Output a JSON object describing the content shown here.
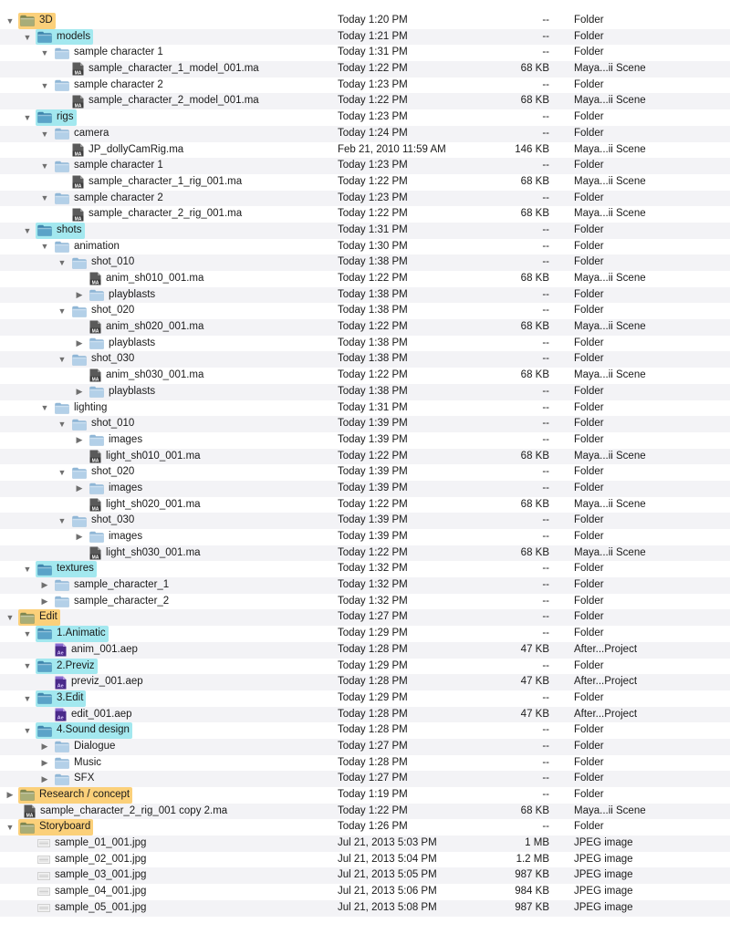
{
  "window": {
    "view": "Finder list view"
  },
  "colors": {
    "row_alt": "#f3f3f6",
    "label_orange": "#fbd07a",
    "label_cyan": "#a3e8ef",
    "folder_blue": "#8fb6d6",
    "folder_olive": "#9aa36a",
    "ae_purple": "#4a2a8a"
  },
  "rows": [
    {
      "name": "3D",
      "depth": 0,
      "disclosure": "open",
      "icon": "folder-icon",
      "label": "orange",
      "date": "Today 1:20 PM",
      "size": "--",
      "kind": "Folder"
    },
    {
      "name": "models",
      "depth": 1,
      "disclosure": "open",
      "icon": "folder-icon",
      "label": "cyan",
      "date": "Today 1:21 PM",
      "size": "--",
      "kind": "Folder"
    },
    {
      "name": "sample character 1",
      "depth": 2,
      "disclosure": "open",
      "icon": "folder-icon",
      "label": "",
      "date": "Today 1:31 PM",
      "size": "--",
      "kind": "Folder"
    },
    {
      "name": "sample_character_1_model_001.ma",
      "depth": 3,
      "disclosure": "none",
      "icon": "maya-file-icon",
      "label": "",
      "date": "Today 1:22 PM",
      "size": "68 KB",
      "kind": "Maya...ii Scene"
    },
    {
      "name": "sample character 2",
      "depth": 2,
      "disclosure": "open",
      "icon": "folder-icon",
      "label": "",
      "date": "Today 1:23 PM",
      "size": "--",
      "kind": "Folder"
    },
    {
      "name": "sample_character_2_model_001.ma",
      "depth": 3,
      "disclosure": "none",
      "icon": "maya-file-icon",
      "label": "",
      "date": "Today 1:22 PM",
      "size": "68 KB",
      "kind": "Maya...ii Scene"
    },
    {
      "name": "rigs",
      "depth": 1,
      "disclosure": "open",
      "icon": "folder-icon",
      "label": "cyan",
      "date": "Today 1:23 PM",
      "size": "--",
      "kind": "Folder"
    },
    {
      "name": "camera",
      "depth": 2,
      "disclosure": "open",
      "icon": "folder-icon",
      "label": "",
      "date": "Today 1:24 PM",
      "size": "--",
      "kind": "Folder"
    },
    {
      "name": "JP_dollyCamRig.ma",
      "depth": 3,
      "disclosure": "none",
      "icon": "maya-file-icon",
      "label": "",
      "date": "Feb 21, 2010 11:59 AM",
      "size": "146 KB",
      "kind": "Maya...ii Scene"
    },
    {
      "name": "sample character 1",
      "depth": 2,
      "disclosure": "open",
      "icon": "folder-icon",
      "label": "",
      "date": "Today 1:23 PM",
      "size": "--",
      "kind": "Folder"
    },
    {
      "name": "sample_character_1_rig_001.ma",
      "depth": 3,
      "disclosure": "none",
      "icon": "maya-file-icon",
      "label": "",
      "date": "Today 1:22 PM",
      "size": "68 KB",
      "kind": "Maya...ii Scene"
    },
    {
      "name": "sample character 2",
      "depth": 2,
      "disclosure": "open",
      "icon": "folder-icon",
      "label": "",
      "date": "Today 1:23 PM",
      "size": "--",
      "kind": "Folder"
    },
    {
      "name": "sample_character_2_rig_001.ma",
      "depth": 3,
      "disclosure": "none",
      "icon": "maya-file-icon",
      "label": "",
      "date": "Today 1:22 PM",
      "size": "68 KB",
      "kind": "Maya...ii Scene"
    },
    {
      "name": "shots",
      "depth": 1,
      "disclosure": "open",
      "icon": "folder-icon",
      "label": "cyan",
      "date": "Today 1:31 PM",
      "size": "--",
      "kind": "Folder"
    },
    {
      "name": "animation",
      "depth": 2,
      "disclosure": "open",
      "icon": "folder-icon",
      "label": "",
      "date": "Today 1:30 PM",
      "size": "--",
      "kind": "Folder"
    },
    {
      "name": "shot_010",
      "depth": 3,
      "disclosure": "open",
      "icon": "folder-icon",
      "label": "",
      "date": "Today 1:38 PM",
      "size": "--",
      "kind": "Folder"
    },
    {
      "name": "anim_sh010_001.ma",
      "depth": 4,
      "disclosure": "none",
      "icon": "maya-file-icon",
      "label": "",
      "date": "Today 1:22 PM",
      "size": "68 KB",
      "kind": "Maya...ii Scene"
    },
    {
      "name": "playblasts",
      "depth": 4,
      "disclosure": "closed",
      "icon": "folder-icon",
      "label": "",
      "date": "Today 1:38 PM",
      "size": "--",
      "kind": "Folder"
    },
    {
      "name": "shot_020",
      "depth": 3,
      "disclosure": "open",
      "icon": "folder-icon",
      "label": "",
      "date": "Today 1:38 PM",
      "size": "--",
      "kind": "Folder"
    },
    {
      "name": "anim_sh020_001.ma",
      "depth": 4,
      "disclosure": "none",
      "icon": "maya-file-icon",
      "label": "",
      "date": "Today 1:22 PM",
      "size": "68 KB",
      "kind": "Maya...ii Scene"
    },
    {
      "name": "playblasts",
      "depth": 4,
      "disclosure": "closed",
      "icon": "folder-icon",
      "label": "",
      "date": "Today 1:38 PM",
      "size": "--",
      "kind": "Folder"
    },
    {
      "name": "shot_030",
      "depth": 3,
      "disclosure": "open",
      "icon": "folder-icon",
      "label": "",
      "date": "Today 1:38 PM",
      "size": "--",
      "kind": "Folder"
    },
    {
      "name": "anim_sh030_001.ma",
      "depth": 4,
      "disclosure": "none",
      "icon": "maya-file-icon",
      "label": "",
      "date": "Today 1:22 PM",
      "size": "68 KB",
      "kind": "Maya...ii Scene"
    },
    {
      "name": "playblasts",
      "depth": 4,
      "disclosure": "closed",
      "icon": "folder-icon",
      "label": "",
      "date": "Today 1:38 PM",
      "size": "--",
      "kind": "Folder"
    },
    {
      "name": "lighting",
      "depth": 2,
      "disclosure": "open",
      "icon": "folder-icon",
      "label": "",
      "date": "Today 1:31 PM",
      "size": "--",
      "kind": "Folder"
    },
    {
      "name": "shot_010",
      "depth": 3,
      "disclosure": "open",
      "icon": "folder-icon",
      "label": "",
      "date": "Today 1:39 PM",
      "size": "--",
      "kind": "Folder"
    },
    {
      "name": "images",
      "depth": 4,
      "disclosure": "closed",
      "icon": "folder-icon",
      "label": "",
      "date": "Today 1:39 PM",
      "size": "--",
      "kind": "Folder"
    },
    {
      "name": "light_sh010_001.ma",
      "depth": 4,
      "disclosure": "none",
      "icon": "maya-file-icon",
      "label": "",
      "date": "Today 1:22 PM",
      "size": "68 KB",
      "kind": "Maya...ii Scene"
    },
    {
      "name": "shot_020",
      "depth": 3,
      "disclosure": "open",
      "icon": "folder-icon",
      "label": "",
      "date": "Today 1:39 PM",
      "size": "--",
      "kind": "Folder"
    },
    {
      "name": "images",
      "depth": 4,
      "disclosure": "closed",
      "icon": "folder-icon",
      "label": "",
      "date": "Today 1:39 PM",
      "size": "--",
      "kind": "Folder"
    },
    {
      "name": "light_sh020_001.ma",
      "depth": 4,
      "disclosure": "none",
      "icon": "maya-file-icon",
      "label": "",
      "date": "Today 1:22 PM",
      "size": "68 KB",
      "kind": "Maya...ii Scene"
    },
    {
      "name": "shot_030",
      "depth": 3,
      "disclosure": "open",
      "icon": "folder-icon",
      "label": "",
      "date": "Today 1:39 PM",
      "size": "--",
      "kind": "Folder"
    },
    {
      "name": "images",
      "depth": 4,
      "disclosure": "closed",
      "icon": "folder-icon",
      "label": "",
      "date": "Today 1:39 PM",
      "size": "--",
      "kind": "Folder"
    },
    {
      "name": "light_sh030_001.ma",
      "depth": 4,
      "disclosure": "none",
      "icon": "maya-file-icon",
      "label": "",
      "date": "Today 1:22 PM",
      "size": "68 KB",
      "kind": "Maya...ii Scene"
    },
    {
      "name": "textures",
      "depth": 1,
      "disclosure": "open",
      "icon": "folder-icon",
      "label": "cyan",
      "date": "Today 1:32 PM",
      "size": "--",
      "kind": "Folder"
    },
    {
      "name": "sample_character_1",
      "depth": 2,
      "disclosure": "closed",
      "icon": "folder-icon",
      "label": "",
      "date": "Today 1:32 PM",
      "size": "--",
      "kind": "Folder"
    },
    {
      "name": "sample_character_2",
      "depth": 2,
      "disclosure": "closed",
      "icon": "folder-icon",
      "label": "",
      "date": "Today 1:32 PM",
      "size": "--",
      "kind": "Folder"
    },
    {
      "name": "Edit",
      "depth": 0,
      "disclosure": "open",
      "icon": "folder-icon",
      "label": "orange",
      "date": "Today 1:27 PM",
      "size": "--",
      "kind": "Folder"
    },
    {
      "name": "1.Animatic",
      "depth": 1,
      "disclosure": "open",
      "icon": "folder-icon",
      "label": "cyan",
      "date": "Today 1:29 PM",
      "size": "--",
      "kind": "Folder"
    },
    {
      "name": "anim_001.aep",
      "depth": 2,
      "disclosure": "none",
      "icon": "after-effects-file-icon",
      "label": "",
      "date": "Today 1:28 PM",
      "size": "47 KB",
      "kind": "After...Project"
    },
    {
      "name": "2.Previz",
      "depth": 1,
      "disclosure": "open",
      "icon": "folder-icon",
      "label": "cyan",
      "date": "Today 1:29 PM",
      "size": "--",
      "kind": "Folder"
    },
    {
      "name": "previz_001.aep",
      "depth": 2,
      "disclosure": "none",
      "icon": "after-effects-file-icon",
      "label": "",
      "date": "Today 1:28 PM",
      "size": "47 KB",
      "kind": "After...Project"
    },
    {
      "name": "3.Edit",
      "depth": 1,
      "disclosure": "open",
      "icon": "folder-icon",
      "label": "cyan",
      "date": "Today 1:29 PM",
      "size": "--",
      "kind": "Folder"
    },
    {
      "name": "edit_001.aep",
      "depth": 2,
      "disclosure": "none",
      "icon": "after-effects-file-icon",
      "label": "",
      "date": "Today 1:28 PM",
      "size": "47 KB",
      "kind": "After...Project"
    },
    {
      "name": "4.Sound design",
      "depth": 1,
      "disclosure": "open",
      "icon": "folder-icon",
      "label": "cyan",
      "date": "Today 1:28 PM",
      "size": "--",
      "kind": "Folder"
    },
    {
      "name": "Dialogue",
      "depth": 2,
      "disclosure": "closed",
      "icon": "folder-icon",
      "label": "",
      "date": "Today 1:27 PM",
      "size": "--",
      "kind": "Folder"
    },
    {
      "name": "Music",
      "depth": 2,
      "disclosure": "closed",
      "icon": "folder-icon",
      "label": "",
      "date": "Today 1:28 PM",
      "size": "--",
      "kind": "Folder"
    },
    {
      "name": "SFX",
      "depth": 2,
      "disclosure": "closed",
      "icon": "folder-icon",
      "label": "",
      "date": "Today 1:27 PM",
      "size": "--",
      "kind": "Folder"
    },
    {
      "name": "Research / concept",
      "depth": 0,
      "disclosure": "closed",
      "icon": "folder-icon",
      "label": "orange",
      "date": "Today 1:19 PM",
      "size": "--",
      "kind": "Folder"
    },
    {
      "name": "sample_character_2_rig_001 copy 2.ma",
      "depth": 1,
      "disclosure": "none",
      "icon": "maya-file-icon",
      "label": "",
      "date": "Today 1:22 PM",
      "size": "68 KB",
      "kind": "Maya...ii Scene",
      "outdent": true
    },
    {
      "name": "Storyboard",
      "depth": 0,
      "disclosure": "open",
      "icon": "folder-icon",
      "label": "orange",
      "date": "Today 1:26 PM",
      "size": "--",
      "kind": "Folder"
    },
    {
      "name": "sample_01_001.jpg",
      "depth": 1,
      "disclosure": "none",
      "icon": "jpeg-file-icon",
      "label": "",
      "date": "Jul 21, 2013 5:03 PM",
      "size": "1 MB",
      "kind": "JPEG image"
    },
    {
      "name": "sample_02_001.jpg",
      "depth": 1,
      "disclosure": "none",
      "icon": "jpeg-file-icon",
      "label": "",
      "date": "Jul 21, 2013 5:04 PM",
      "size": "1.2 MB",
      "kind": "JPEG image"
    },
    {
      "name": "sample_03_001.jpg",
      "depth": 1,
      "disclosure": "none",
      "icon": "jpeg-file-icon",
      "label": "",
      "date": "Jul 21, 2013 5:05 PM",
      "size": "987 KB",
      "kind": "JPEG image"
    },
    {
      "name": "sample_04_001.jpg",
      "depth": 1,
      "disclosure": "none",
      "icon": "jpeg-file-icon",
      "label": "",
      "date": "Jul 21, 2013 5:06 PM",
      "size": "984 KB",
      "kind": "JPEG image"
    },
    {
      "name": "sample_05_001.jpg",
      "depth": 1,
      "disclosure": "none",
      "icon": "jpeg-file-icon",
      "label": "",
      "date": "Jul 21, 2013 5:08 PM",
      "size": "987 KB",
      "kind": "JPEG image"
    }
  ]
}
